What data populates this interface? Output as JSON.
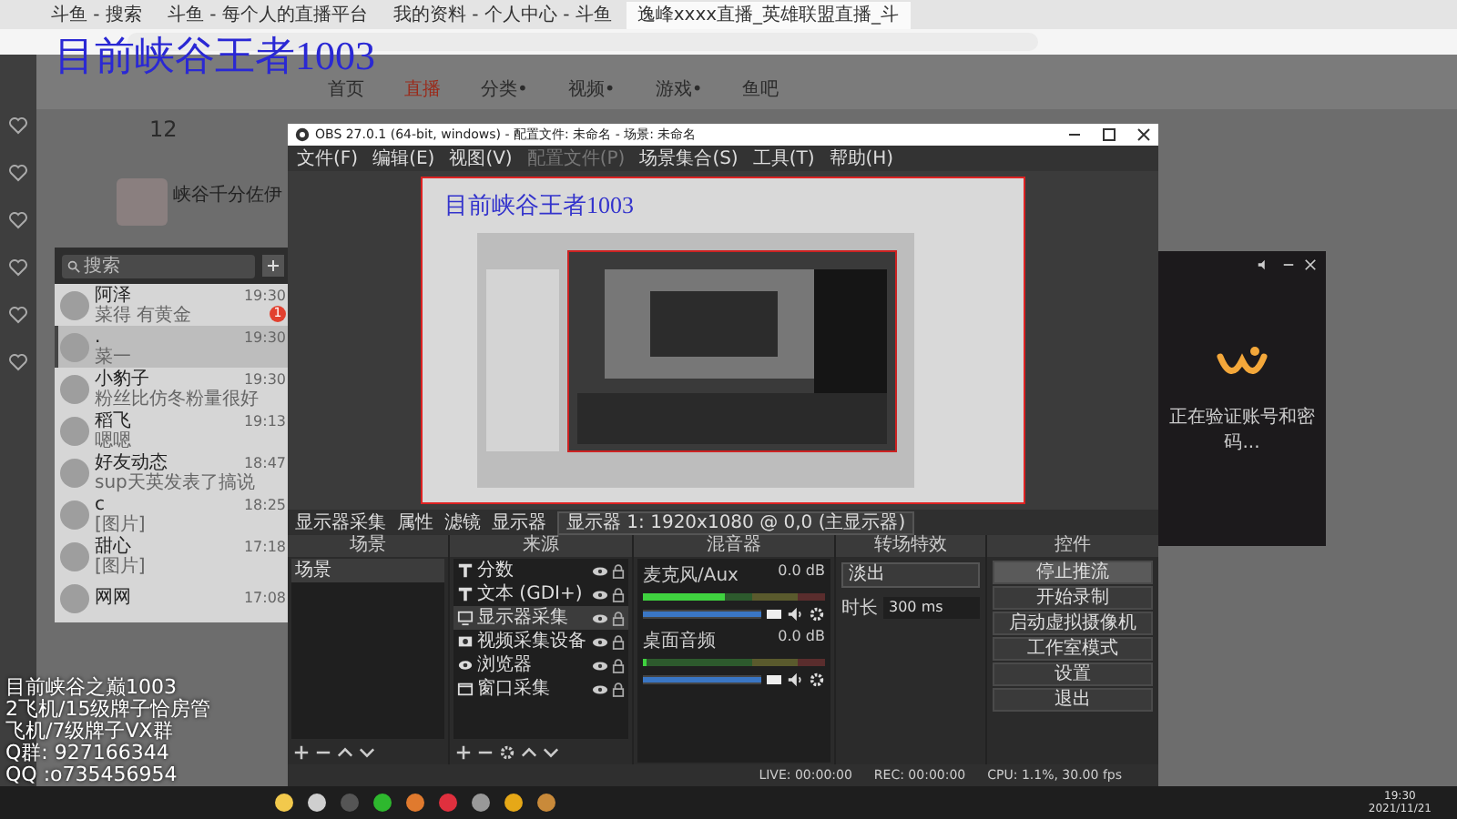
{
  "browser": {
    "tabs": [
      {
        "label": "斗鱼 - 搜索",
        "selected": false
      },
      {
        "label": "斗鱼 - 每个人的直播平台",
        "selected": false
      },
      {
        "label": "我的资料 - 个人中心 - 斗鱼",
        "selected": false
      },
      {
        "label": "逸峰xxxx直播_英雄联盟直播_斗",
        "selected": true
      }
    ]
  },
  "overlay_title": "目前峡谷王者1003",
  "site": {
    "nav": [
      {
        "label": "首页",
        "selected": false
      },
      {
        "label": "直播",
        "selected": true
      },
      {
        "label": "分类•",
        "selected": false
      },
      {
        "label": "视频•",
        "selected": false
      },
      {
        "label": "游戏•",
        "selected": false
      },
      {
        "label": "鱼吧",
        "selected": false
      }
    ],
    "follow_count": "12",
    "streamer_name": "峡谷千分佐伊"
  },
  "chat": {
    "search_placeholder": "搜索",
    "contacts": [
      {
        "name": "阿泽",
        "time": "19:30",
        "message": "菜得 有黄金",
        "badge": "1",
        "selected": false
      },
      {
        "name": ".",
        "time": "19:30",
        "message": "菜一",
        "selected": true
      },
      {
        "name": "小豹子",
        "time": "19:30",
        "message": "粉丝比仿冬粉量很好",
        "selected": false
      },
      {
        "name": "稻飞",
        "time": "19:13",
        "message": "嗯嗯",
        "selected": false
      },
      {
        "name": "好友动态",
        "time": "18:47",
        "message": "sup天英发表了搞说",
        "selected": false
      },
      {
        "name": "c",
        "time": "18:25",
        "message": "[图片]",
        "selected": false
      },
      {
        "name": "甜心",
        "time": "17:18",
        "message": "[图片]",
        "selected": false
      },
      {
        "name": "网网",
        "time": "17:08",
        "selected": false
      }
    ]
  },
  "obs": {
    "title": "OBS 27.0.1 (64-bit, windows) - 配置文件: 未命名 - 场景: 未命名",
    "menu": [
      {
        "label": "文件(F)",
        "disabled": false
      },
      {
        "label": "编辑(E)",
        "disabled": false
      },
      {
        "label": "视图(V)",
        "disabled": false
      },
      {
        "label": "配置文件(P)",
        "disabled": true
      },
      {
        "label": "场景集合(S)",
        "disabled": false
      },
      {
        "label": "工具(T)",
        "disabled": false
      },
      {
        "label": "帮助(H)",
        "disabled": false
      }
    ],
    "preview_title": "目前峡谷王者1003",
    "toolbar": {
      "source": "显示器采集",
      "properties": "属性",
      "filters": "滤镜",
      "display_label": "显示器",
      "display_value": "显示器 1: 1920x1080 @ 0,0 (主显示器)"
    },
    "scenes": {
      "title": "场景",
      "items": [
        {
          "label": "场景",
          "selected": true
        }
      ]
    },
    "sources": {
      "title": "来源",
      "items": [
        {
          "label": "分数",
          "kind": "text",
          "selected": false
        },
        {
          "label": "文本 (GDI+)",
          "kind": "text",
          "selected": false
        },
        {
          "label": "显示器采集",
          "kind": "monitor",
          "selected": true
        },
        {
          "label": "视频采集设备",
          "kind": "camera",
          "selected": false
        },
        {
          "label": "浏览器",
          "kind": "browser",
          "selected": false
        },
        {
          "label": "窗口采集",
          "kind": "window",
          "selected": false
        }
      ]
    },
    "mixer": {
      "title": "混音器",
      "channels": [
        {
          "name": "麦克风/Aux",
          "reading": "0.0 dB",
          "level": 0.45,
          "volume": {
            "level": 1
          }
        },
        {
          "name": "桌面音频",
          "reading": "0.0 dB",
          "level": 0.02,
          "volume": {
            "level": 1
          }
        }
      ]
    },
    "transitions": {
      "title": "转场特效",
      "type": "淡出",
      "duration_label": "时长",
      "duration": "300 ms"
    },
    "controls": {
      "title": "控件",
      "buttons": [
        {
          "label": "停止推流",
          "active": true
        },
        {
          "label": "开始录制",
          "active": false
        },
        {
          "label": "启动虚拟摄像机",
          "active": false
        },
        {
          "label": "工作室模式",
          "active": false
        },
        {
          "label": "设置",
          "active": false
        },
        {
          "label": "退出",
          "active": false
        }
      ]
    },
    "status": [
      "LIVE: 00:00:00",
      "REC: 00:00:00",
      "CPU: 1.1%, 30.00 fps"
    ]
  },
  "login_panel": {
    "message": "正在验证账号和密码..."
  },
  "stream_overlay": [
    "目前峡谷之巅1003",
    "2飞机/15级牌子恰房管",
    "飞机/7级牌子VX群",
    "Q群: 927166344",
    "QQ :o735456954"
  ],
  "taskbar": {
    "time": "19:30",
    "date": "2021/11/21"
  }
}
